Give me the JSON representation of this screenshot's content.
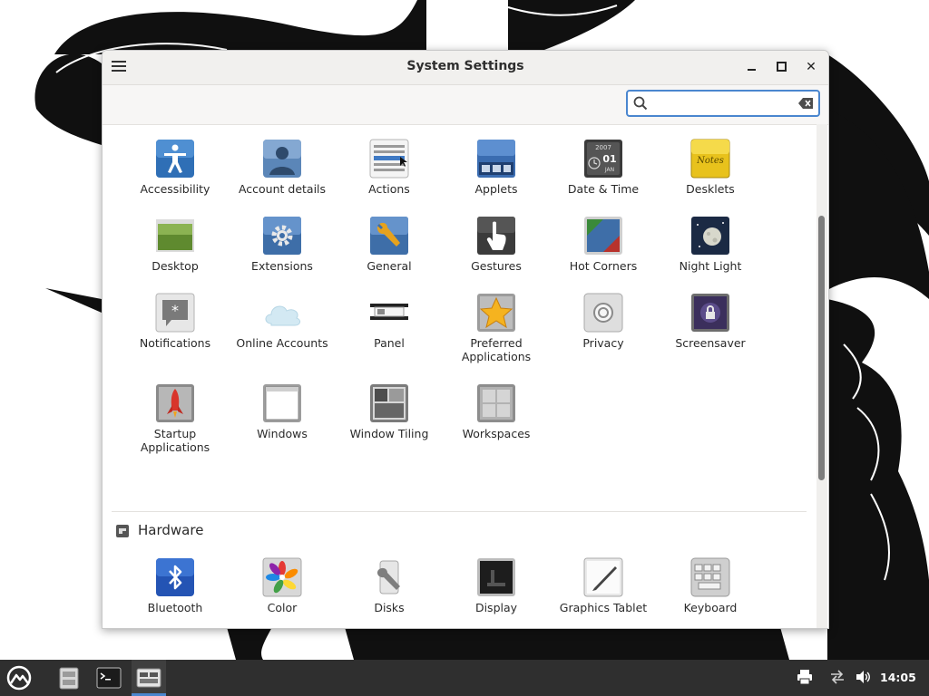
{
  "window": {
    "title": "System Settings",
    "close_glyph": "✕"
  },
  "search": {
    "placeholder": "",
    "value": ""
  },
  "items": [
    {
      "label": "Accessibility",
      "icon": "accessibility-icon"
    },
    {
      "label": "Account details",
      "icon": "account-icon"
    },
    {
      "label": "Actions",
      "icon": "actions-icon"
    },
    {
      "label": "Applets",
      "icon": "applets-icon"
    },
    {
      "label": "Date & Time",
      "icon": "date-time-icon"
    },
    {
      "label": "Desklets",
      "icon": "desklets-icon"
    },
    {
      "label": "Desktop",
      "icon": "desktop-icon"
    },
    {
      "label": "Extensions",
      "icon": "extensions-icon"
    },
    {
      "label": "General",
      "icon": "general-icon"
    },
    {
      "label": "Gestures",
      "icon": "gestures-icon"
    },
    {
      "label": "Hot Corners",
      "icon": "hot-corners-icon"
    },
    {
      "label": "Night Light",
      "icon": "night-light-icon"
    },
    {
      "label": "Notifications",
      "icon": "notifications-icon"
    },
    {
      "label": "Online Accounts",
      "icon": "online-accounts-icon"
    },
    {
      "label": "Panel",
      "icon": "panel-icon"
    },
    {
      "label": "Preferred Applications",
      "icon": "preferred-applications-icon"
    },
    {
      "label": "Privacy",
      "icon": "privacy-icon"
    },
    {
      "label": "Screensaver",
      "icon": "screensaver-icon"
    },
    {
      "label": "Startup Applications",
      "icon": "startup-applications-icon"
    },
    {
      "label": "Windows",
      "icon": "windows-icon"
    },
    {
      "label": "Window Tiling",
      "icon": "window-tiling-icon"
    },
    {
      "label": "Workspaces",
      "icon": "workspaces-icon"
    }
  ],
  "sections": {
    "hardware": {
      "title": "Hardware",
      "items": [
        {
          "label": "Bluetooth",
          "icon": "bluetooth-icon"
        },
        {
          "label": "Color",
          "icon": "color-icon"
        },
        {
          "label": "Disks",
          "icon": "disks-icon"
        },
        {
          "label": "Display",
          "icon": "display-icon"
        },
        {
          "label": "Graphics Tablet",
          "icon": "graphics-tablet-icon"
        },
        {
          "label": "Keyboard",
          "icon": "keyboard-icon"
        }
      ]
    }
  },
  "icon_text": {
    "date_year": "2007",
    "date_day": "01",
    "date_month": "JAN",
    "desklet_note": "Notes"
  },
  "taskbar": {
    "clock": "14:05",
    "launchers": [
      "menu-icon",
      "file-manager-icon",
      "terminal-icon",
      "system-settings-icon"
    ],
    "tray": [
      "printer-icon",
      "network-icon",
      "volume-icon"
    ]
  },
  "colors": {
    "accent": "#4a86cf",
    "taskbar": "#2f2f2f",
    "titlebar": "#f1f0ee"
  }
}
